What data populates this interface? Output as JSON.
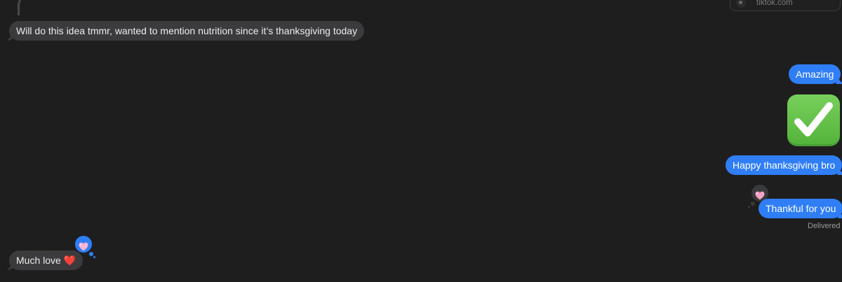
{
  "link_preview": {
    "domain": "tiktok.com"
  },
  "messages": {
    "nutrition": "Will do this idea tmmr, wanted to mention nutrition since it’s thanksgiving today",
    "amazing": "Amazing",
    "happy": "Happy thanksgiving bro",
    "thankful": "Thankful for you",
    "much_love": "Much love ❤️"
  },
  "emoji": {
    "checkmark": "white-heavy-check-mark"
  },
  "status": {
    "delivered": "Delivered"
  },
  "tapbacks": {
    "on_thankful": "pink-heart-icon",
    "on_much_love": "pink-heart-icon"
  },
  "colors": {
    "background": "#1e1e1e",
    "incoming_bubble": "#3b3b3d",
    "outgoing_bubble": "#2f7ef6",
    "checkmark_green": "#5cbd42",
    "delivered_text": "#9a9a9a"
  }
}
